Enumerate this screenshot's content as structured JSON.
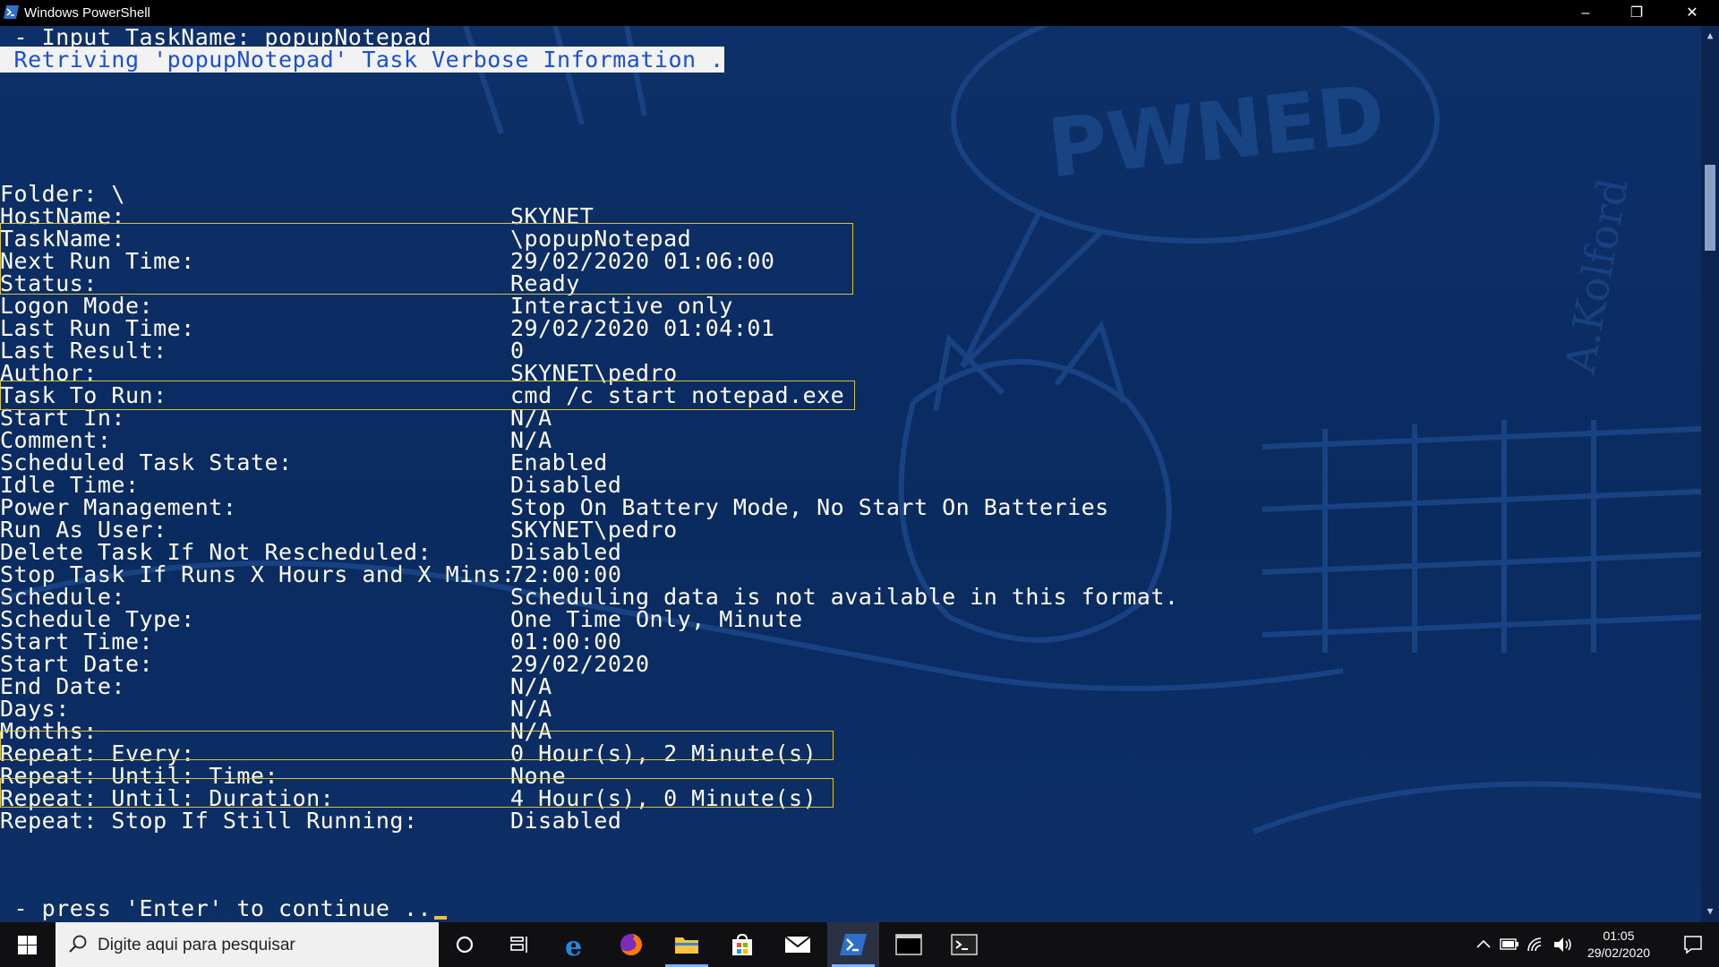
{
  "window": {
    "title": "Windows PowerShell"
  },
  "console": {
    "header_line": " - Input TaskName: popupNotepad",
    "highlight_line": " Retriving 'popupNotepad' Task Verbose Information .",
    "rows": [
      {
        "label": "Folder: \\",
        "value": ""
      },
      {
        "label": "HostName:",
        "value": "SKYNET"
      },
      {
        "label": "TaskName:",
        "value": "\\popupNotepad"
      },
      {
        "label": "Next Run Time:",
        "value": "29/02/2020 01:06:00"
      },
      {
        "label": "Status:",
        "value": "Ready"
      },
      {
        "label": "Logon Mode:",
        "value": "Interactive only"
      },
      {
        "label": "Last Run Time:",
        "value": "29/02/2020 01:04:01"
      },
      {
        "label": "Last Result:",
        "value": "0"
      },
      {
        "label": "Author:",
        "value": "SKYNET\\pedro"
      },
      {
        "label": "Task To Run:",
        "value": "cmd /c start notepad.exe"
      },
      {
        "label": "Start In:",
        "value": "N/A"
      },
      {
        "label": "Comment:",
        "value": "N/A"
      },
      {
        "label": "Scheduled Task State:",
        "value": "Enabled"
      },
      {
        "label": "Idle Time:",
        "value": "Disabled"
      },
      {
        "label": "Power Management:",
        "value": "Stop On Battery Mode, No Start On Batteries"
      },
      {
        "label": "Run As User:",
        "value": "SKYNET\\pedro"
      },
      {
        "label": "Delete Task If Not Rescheduled:",
        "value": "Disabled"
      },
      {
        "label": "Stop Task If Runs X Hours and X Mins:",
        "value": "72:00:00"
      },
      {
        "label": "Schedule:",
        "value": "Scheduling data is not available in this format."
      },
      {
        "label": "Schedule Type:",
        "value": "One Time Only, Minute"
      },
      {
        "label": "Start Time:",
        "value": "01:00:00"
      },
      {
        "label": "Start Date:",
        "value": "29/02/2020"
      },
      {
        "label": "End Date:",
        "value": "N/A"
      },
      {
        "label": "Days:",
        "value": "N/A"
      },
      {
        "label": "Months:",
        "value": "N/A"
      },
      {
        "label": "Repeat: Every:",
        "value": "0 Hour(s), 2 Minute(s)"
      },
      {
        "label": "Repeat: Until: Time:",
        "value": "None"
      },
      {
        "label": "Repeat: Until: Duration:",
        "value": "4 Hour(s), 0 Minute(s)"
      },
      {
        "label": "Repeat: Stop If Still Running:",
        "value": "Disabled"
      }
    ],
    "prompt_line": " - press 'Enter' to continue ..",
    "wallpaper_text": "PWNED",
    "wallpaper_signature": "A.Kolford"
  },
  "taskbar": {
    "search_placeholder": "Digite aqui para pesquisar",
    "clock_time": "01:05",
    "clock_date": "29/02/2020"
  },
  "colors": {
    "console_bg": "#0a2b60",
    "highlight_fg": "#1a4fd6",
    "box_border": "#d8c33a"
  }
}
